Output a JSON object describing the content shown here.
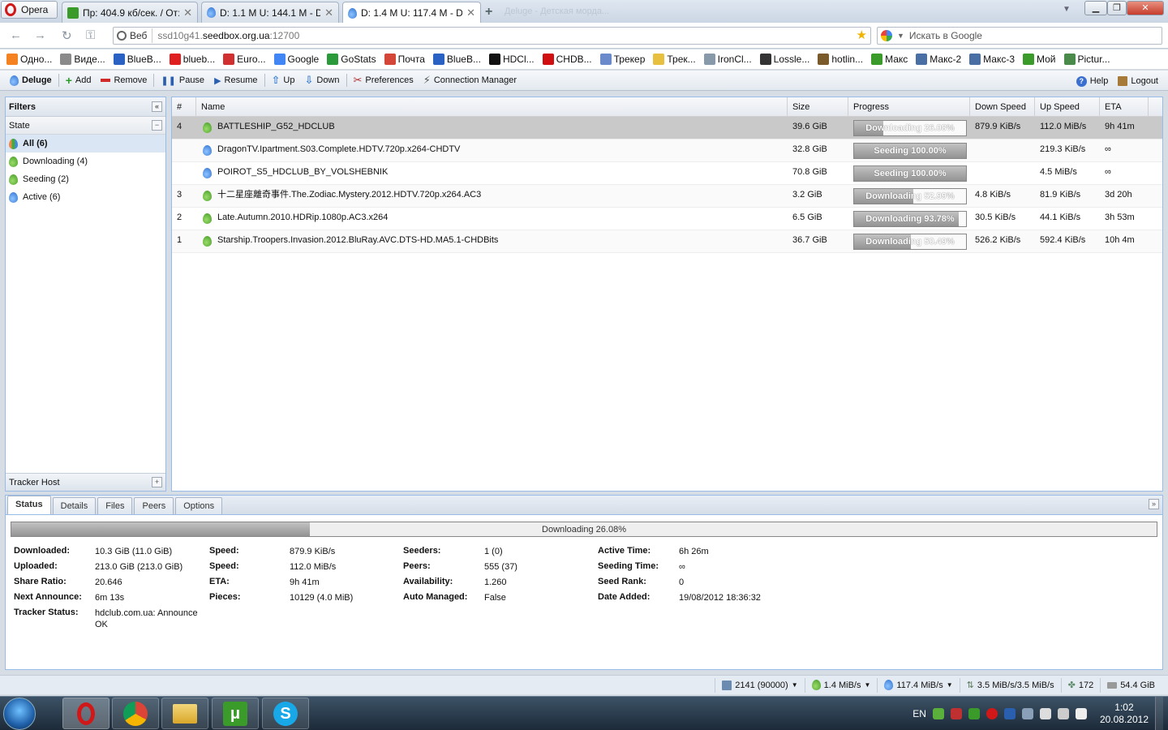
{
  "browser": {
    "menu_label": "Opera",
    "tabs": [
      {
        "title": "Пр: 404.9 кб/сек. / От:"
      },
      {
        "title": "D: 1.1 M U: 144.1 M - D..."
      },
      {
        "title": "D: 1.4 M U: 117.4 M - D..."
      }
    ],
    "faded_tab": "Деluge - Детская морда...",
    "url_badge": "Веб",
    "url_prefix": "ssd10g41.",
    "url_host": "seedbox.org.ua",
    "url_port": ":12700",
    "search_placeholder": "Искать в Google",
    "bookmarks": [
      {
        "label": "Одно...",
        "color": "#f58220"
      },
      {
        "label": "Виде...",
        "color": "#8a8a8a"
      },
      {
        "label": "BlueB...",
        "color": "#2a62c4"
      },
      {
        "label": "blueb...",
        "color": "#e02020"
      },
      {
        "label": "Euro...",
        "color": "#d03030"
      },
      {
        "label": "Google",
        "color": "#4285f4"
      },
      {
        "label": "GoStats",
        "color": "#2a9a3a"
      },
      {
        "label": "Почта",
        "color": "#d44638"
      },
      {
        "label": "BlueB...",
        "color": "#2a62c4"
      },
      {
        "label": "HDCl...",
        "color": "#111111"
      },
      {
        "label": "CHDB...",
        "color": "#d01010"
      },
      {
        "label": "Трекер",
        "color": "#6a8acb"
      },
      {
        "label": "Трек...",
        "color": "#e8c040"
      },
      {
        "label": "IronCl...",
        "color": "#8899aa"
      },
      {
        "label": "Lossle...",
        "color": "#333333"
      },
      {
        "label": "hotlin...",
        "color": "#7a5a2a"
      },
      {
        "label": "Макс",
        "color": "#3a9a2a"
      },
      {
        "label": "Макс-2",
        "color": "#4a6fa5"
      },
      {
        "label": "Макс-3",
        "color": "#4a6fa5"
      },
      {
        "label": "Мой",
        "color": "#3a9a2a"
      },
      {
        "label": "Pictur...",
        "color": "#4a8a4a"
      }
    ]
  },
  "toolbar": {
    "app_name": "Deluge",
    "add": "Add",
    "remove": "Remove",
    "pause": "Pause",
    "resume": "Resume",
    "up": "Up",
    "down": "Down",
    "preferences": "Preferences",
    "connection_manager": "Connection Manager",
    "help": "Help",
    "logout": "Logout"
  },
  "filters": {
    "title": "Filters",
    "state_label": "State",
    "items": [
      {
        "label": "All (6)",
        "icon": "all-icon"
      },
      {
        "label": "Downloading (4)",
        "icon": "downloading-icon"
      },
      {
        "label": "Seeding (2)",
        "icon": "seeding-icon"
      },
      {
        "label": "Active (6)",
        "icon": "active-icon"
      }
    ],
    "tracker_host_label": "Tracker Host"
  },
  "grid": {
    "columns": [
      "#",
      "Name",
      "Size",
      "Progress",
      "Down Speed",
      "Up Speed",
      "ETA"
    ],
    "rows": [
      {
        "num": "4",
        "state": "downloading",
        "name": "BATTLESHIP_G52_HDCLUB",
        "size": "39.6 GiB",
        "progress": 26.08,
        "progress_text": "Downloading 26.08%",
        "down": "879.9 KiB/s",
        "up": "112.0 MiB/s",
        "eta": "9h 41m",
        "selected": true
      },
      {
        "num": "",
        "state": "seeding",
        "name": "DragonTV.Ipartment.S03.Complete.HDTV.720p.x264-CHDTV",
        "size": "32.8 GiB",
        "progress": 100,
        "progress_text": "Seeding 100.00%",
        "down": "",
        "up": "219.3 KiB/s",
        "eta": "∞",
        "selected": false
      },
      {
        "num": "",
        "state": "seeding",
        "name": "POIROT_S5_HDCLUB_BY_VOLSHEBNIK",
        "size": "70.8 GiB",
        "progress": 100,
        "progress_text": "Seeding 100.00%",
        "down": "",
        "up": "4.5 MiB/s",
        "eta": "∞",
        "selected": false
      },
      {
        "num": "3",
        "state": "downloading",
        "name": "十二星座離奇事件.The.Zodiac.Mystery.2012.HDTV.720p.x264.AC3",
        "size": "3.2 GiB",
        "progress": 52.99,
        "progress_text": "Downloading 52.99%",
        "down": "4.8 KiB/s",
        "up": "81.9 KiB/s",
        "eta": "3d 20h",
        "selected": false
      },
      {
        "num": "2",
        "state": "downloading",
        "name": "Late.Autumn.2010.HDRip.1080p.AC3.x264",
        "size": "6.5 GiB",
        "progress": 93.78,
        "progress_text": "Downloading 93.78%",
        "down": "30.5 KiB/s",
        "up": "44.1 KiB/s",
        "eta": "3h 53m",
        "selected": false
      },
      {
        "num": "1",
        "state": "downloading",
        "name": "Starship.Troopers.Invasion.2012.BluRay.AVC.DTS-HD.MA5.1-CHDBits",
        "size": "36.7 GiB",
        "progress": 50.49,
        "progress_text": "Downloading 50.49%",
        "down": "526.2 KiB/s",
        "up": "592.4 KiB/s",
        "eta": "10h 4m",
        "selected": false
      }
    ]
  },
  "details": {
    "tabs": [
      "Status",
      "Details",
      "Files",
      "Peers",
      "Options"
    ],
    "progress": 26.08,
    "progress_text": "Downloading 26.08%",
    "col1": [
      {
        "label": "Downloaded:",
        "value": "10.3 GiB (11.0 GiB)"
      },
      {
        "label": "Uploaded:",
        "value": "213.0 GiB (213.0 GiB)"
      },
      {
        "label": "Share Ratio:",
        "value": "20.646"
      },
      {
        "label": "Next Announce:",
        "value": "6m 13s"
      },
      {
        "label": "Tracker Status:",
        "value": "hdclub.com.ua: Announce OK"
      }
    ],
    "col2": [
      {
        "label": "Speed:",
        "value": "879.9 KiB/s"
      },
      {
        "label": "Speed:",
        "value": "112.0 MiB/s"
      },
      {
        "label": "ETA:",
        "value": "9h 41m"
      },
      {
        "label": "Pieces:",
        "value": "10129 (4.0 MiB)"
      }
    ],
    "col3": [
      {
        "label": "Seeders:",
        "value": "1 (0)"
      },
      {
        "label": "Peers:",
        "value": "555 (37)"
      },
      {
        "label": "Availability:",
        "value": "1.260"
      },
      {
        "label": "Auto Managed:",
        "value": "False"
      }
    ],
    "col4": [
      {
        "label": "Active Time:",
        "value": "6h 26m"
      },
      {
        "label": "Seeding Time:",
        "value": "∞"
      },
      {
        "label": "Seed Rank:",
        "value": "0"
      },
      {
        "label": "Date Added:",
        "value": "19/08/2012 18:36:32"
      }
    ]
  },
  "statusbar": {
    "connections": "2141 (90000)",
    "down_speed": "1.4 MiB/s",
    "up_speed": "117.4 MiB/s",
    "protocol": "3.5 MiB/s/3.5 MiB/s",
    "dht": "172",
    "free_space": "54.4 GiB"
  },
  "taskbar": {
    "lang": "EN",
    "time": "1:02",
    "date": "20.08.2012"
  }
}
